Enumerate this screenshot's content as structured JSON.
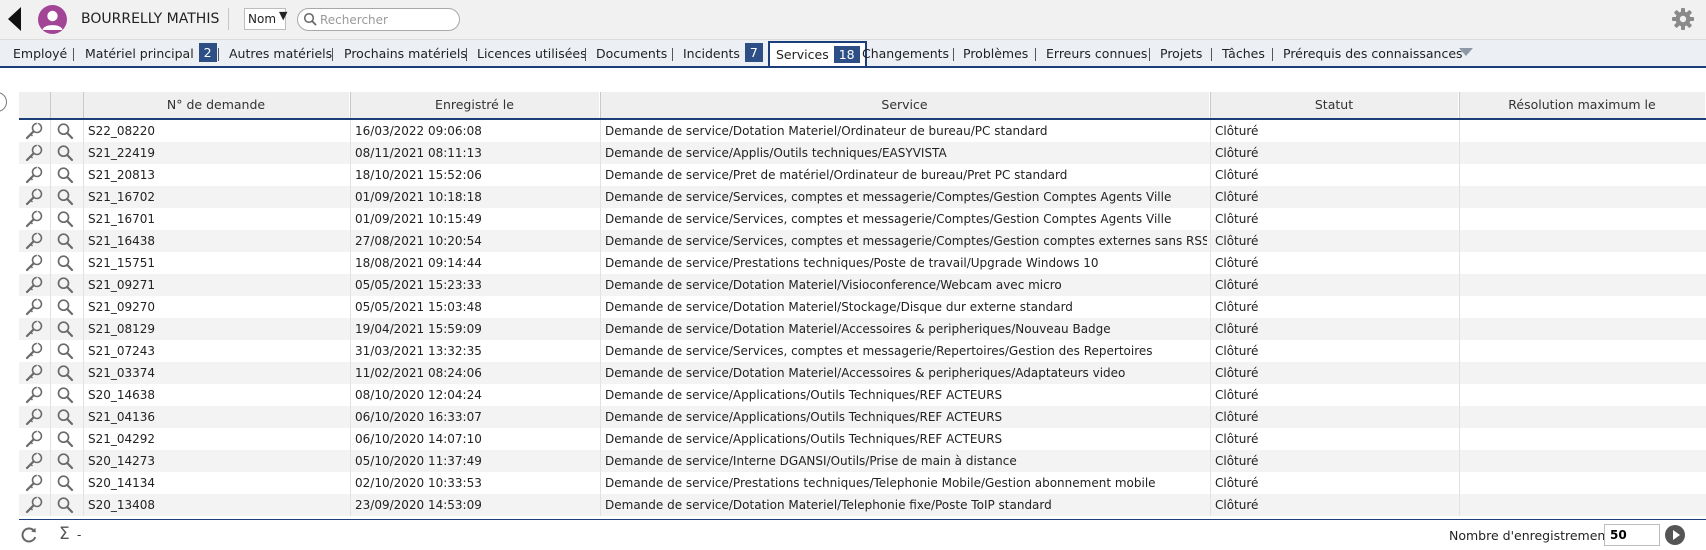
{
  "header": {
    "user_name": "BOURRELLY MATHIS",
    "field_selector": "Nom",
    "search_placeholder": "Rechercher"
  },
  "tabs": [
    {
      "label": "Employé",
      "active": false
    },
    {
      "label": "Matériel principal",
      "badge": "2",
      "active": false
    },
    {
      "label": "Autres matériels",
      "active": false
    },
    {
      "label": "Prochains matériels",
      "active": false
    },
    {
      "label": "Licences utilisées",
      "active": false
    },
    {
      "label": "Documents",
      "active": false
    },
    {
      "label": "Incidents",
      "badge": "7",
      "active": false
    },
    {
      "label": "Services",
      "badge": "18",
      "active": true
    },
    {
      "label": "Changements",
      "active": false
    },
    {
      "label": "Problèmes",
      "active": false
    },
    {
      "label": "Erreurs connues",
      "active": false
    },
    {
      "label": "Projets",
      "active": false
    },
    {
      "label": "Tâches",
      "active": false
    },
    {
      "label": "Prérequis des connaissances",
      "active": false
    }
  ],
  "grid": {
    "columns": [
      "N° de demande",
      "Enregistré le",
      "Service",
      "Statut",
      "Résolution maximum le"
    ],
    "rows": [
      {
        "id": "S22_08220",
        "date": "16/03/2022 09:06:08",
        "service": "Demande de service/Dotation Materiel/Ordinateur de bureau/PC standard",
        "status": "Clôturé",
        "resolution": ""
      },
      {
        "id": "S21_22419",
        "date": "08/11/2021 08:11:13",
        "service": "Demande de service/Applis/Outils techniques/EASYVISTA",
        "status": "Clôturé",
        "resolution": ""
      },
      {
        "id": "S21_20813",
        "date": "18/10/2021 15:52:06",
        "service": "Demande de service/Pret de matériel/Ordinateur de bureau/Pret PC standard",
        "status": "Clôturé",
        "resolution": ""
      },
      {
        "id": "S21_16702",
        "date": "01/09/2021 10:18:18",
        "service": "Demande de service/Services, comptes et messagerie/Comptes/Gestion Comptes Agents Ville",
        "status": "Clôturé",
        "resolution": ""
      },
      {
        "id": "S21_16701",
        "date": "01/09/2021 10:15:49",
        "service": "Demande de service/Services, comptes et messagerie/Comptes/Gestion Comptes Agents Ville",
        "status": "Clôturé",
        "resolution": ""
      },
      {
        "id": "S21_16438",
        "date": "27/08/2021 10:20:54",
        "service": "Demande de service/Services, comptes et messagerie/Comptes/Gestion comptes externes sans RSSI",
        "status": "Clôturé",
        "resolution": ""
      },
      {
        "id": "S21_15751",
        "date": "18/08/2021 09:14:44",
        "service": "Demande de service/Prestations techniques/Poste de travail/Upgrade Windows 10",
        "status": "Clôturé",
        "resolution": ""
      },
      {
        "id": "S21_09271",
        "date": "05/05/2021 15:23:33",
        "service": "Demande de service/Dotation Materiel/Visioconference/Webcam avec micro",
        "status": "Clôturé",
        "resolution": ""
      },
      {
        "id": "S21_09270",
        "date": "05/05/2021 15:03:48",
        "service": "Demande de service/Dotation Materiel/Stockage/Disque dur externe standard",
        "status": "Clôturé",
        "resolution": ""
      },
      {
        "id": "S21_08129",
        "date": "19/04/2021 15:59:09",
        "service": "Demande de service/Dotation Materiel/Accessoires & peripheriques/Nouveau Badge",
        "status": "Clôturé",
        "resolution": ""
      },
      {
        "id": "S21_07243",
        "date": "31/03/2021 13:32:35",
        "service": "Demande de service/Services, comptes et messagerie/Repertoires/Gestion des Repertoires",
        "status": "Clôturé",
        "resolution": ""
      },
      {
        "id": "S21_03374",
        "date": "11/02/2021 08:24:06",
        "service": "Demande de service/Dotation Materiel/Accessoires & peripheriques/Adaptateurs video",
        "status": "Clôturé",
        "resolution": ""
      },
      {
        "id": "S20_14638",
        "date": "08/10/2020 12:04:24",
        "service": "Demande de service/Applications/Outils Techniques/REF ACTEURS",
        "status": "Clôturé",
        "resolution": ""
      },
      {
        "id": "S21_04136",
        "date": "06/10/2020 16:33:07",
        "service": "Demande de service/Applications/Outils Techniques/REF ACTEURS",
        "status": "Clôturé",
        "resolution": ""
      },
      {
        "id": "S21_04292",
        "date": "06/10/2020 14:07:10",
        "service": "Demande de service/Applications/Outils Techniques/REF ACTEURS",
        "status": "Clôturé",
        "resolution": ""
      },
      {
        "id": "S20_14273",
        "date": "05/10/2020 11:37:49",
        "service": "Demande de service/Interne DGANSI/Outils/Prise de main à distance",
        "status": "Clôturé",
        "resolution": ""
      },
      {
        "id": "S20_14134",
        "date": "02/10/2020 10:33:53",
        "service": "Demande de service/Prestations techniques/Telephonie Mobile/Gestion abonnement mobile",
        "status": "Clôturé",
        "resolution": ""
      },
      {
        "id": "S20_13408",
        "date": "23/09/2020 14:53:09",
        "service": "Demande de service/Dotation Materiel/Telephonie fixe/Poste ToIP standard",
        "status": "Clôturé",
        "resolution": ""
      }
    ]
  },
  "footer": {
    "sigma_value": "-",
    "records_label": "Nombre d'enregistrements",
    "records_value": "50"
  },
  "icons": {
    "back": "back-arrow-icon",
    "avatar": "user-avatar-icon",
    "search": "search-icon",
    "settings": "gear-icon",
    "row_edit": "edit-wrench-icon",
    "row_view": "magnifier-icon",
    "refresh": "refresh-icon",
    "sum": "sigma-icon",
    "next": "next-page-icon"
  },
  "colors": {
    "accent": "#1c3f7a",
    "badge": "#2d4f86",
    "avatar": "#a34596"
  }
}
